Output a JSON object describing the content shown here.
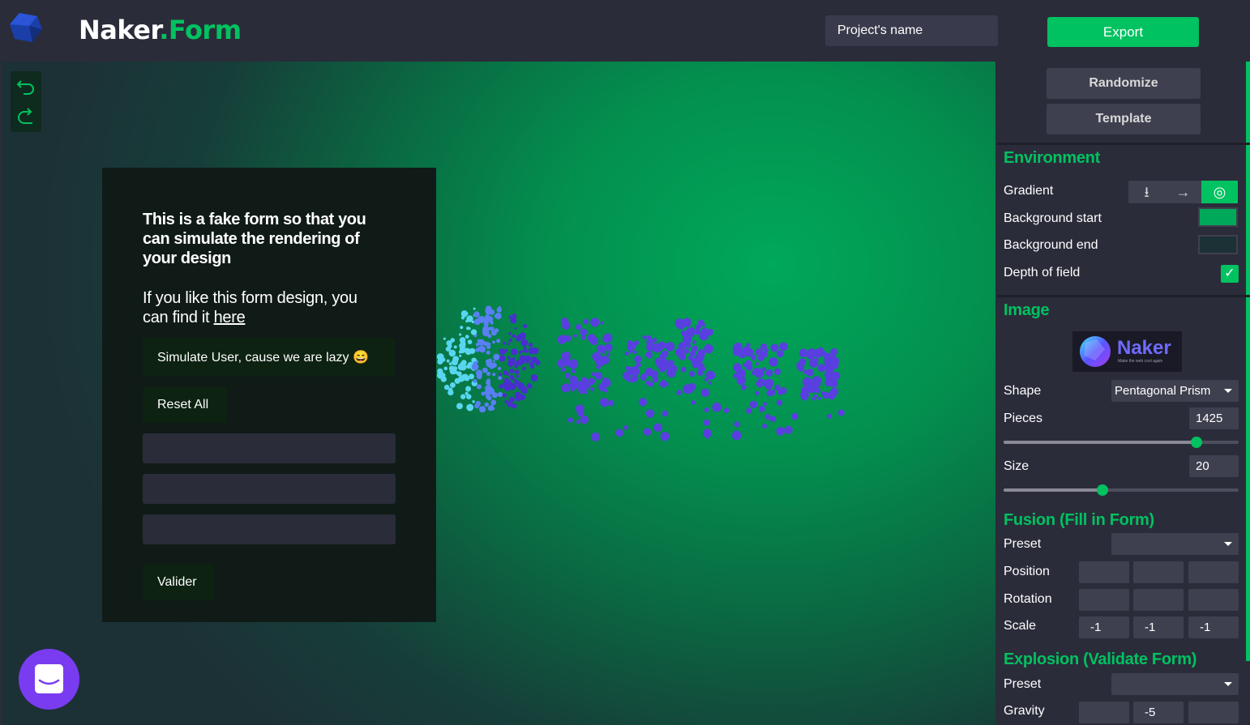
{
  "header": {
    "brand_name": "Naker",
    "brand_dot": ".",
    "brand_suffix": "Form",
    "project_placeholder": "Project's name",
    "export_label": "Export",
    "logo_icon": "gem-logo-icon"
  },
  "canvas": {
    "undo_icon": "undo-icon",
    "redo_icon": "redo-icon",
    "fake_form": {
      "title": "This is a fake form so that you can simulate the rendering of your design",
      "text": "If you like this form design, you can find it ",
      "link": "here",
      "simulate_label": "Simulate User, cause we are lazy 😄",
      "reset_label": "Reset All",
      "submit_label": "Valider"
    },
    "chat_icon": "chat-icon"
  },
  "panel": {
    "randomize_label": "Randomize",
    "template_label": "Template",
    "environment": {
      "title": "Environment",
      "gradient_label": "Gradient",
      "gradient_options": [
        "⭳",
        "→",
        "◎"
      ],
      "gradient_selected": 2,
      "bg_start_label": "Background start",
      "bg_start_color": "#00a85a",
      "bg_end_label": "Background end",
      "bg_end_color": "#1c3136",
      "dof_label": "Depth of field",
      "dof_checked": true,
      "check_mark": "✓"
    },
    "image": {
      "title": "Image",
      "thumb_name": "Naker",
      "thumb_tagline": "Make the web cool again",
      "shape_label": "Shape",
      "shape_value": "Pentagonal Prism",
      "pieces_label": "Pieces",
      "pieces_value": "1425",
      "pieces_fraction": 0.82,
      "size_label": "Size",
      "size_value": "20",
      "size_fraction": 0.42
    },
    "fusion": {
      "title": "Fusion (Fill in Form)",
      "preset_label": "Preset",
      "preset_value": "",
      "position_label": "Position",
      "rotation_label": "Rotation",
      "scale_label": "Scale",
      "scale_values": [
        "-1",
        "-1",
        "-1"
      ]
    },
    "explosion": {
      "title": "Explosion (Validate Form)",
      "preset_label": "Preset",
      "preset_value": "",
      "gravity_label": "Gravity",
      "gravity_values": [
        "",
        "-5",
        ""
      ]
    }
  }
}
